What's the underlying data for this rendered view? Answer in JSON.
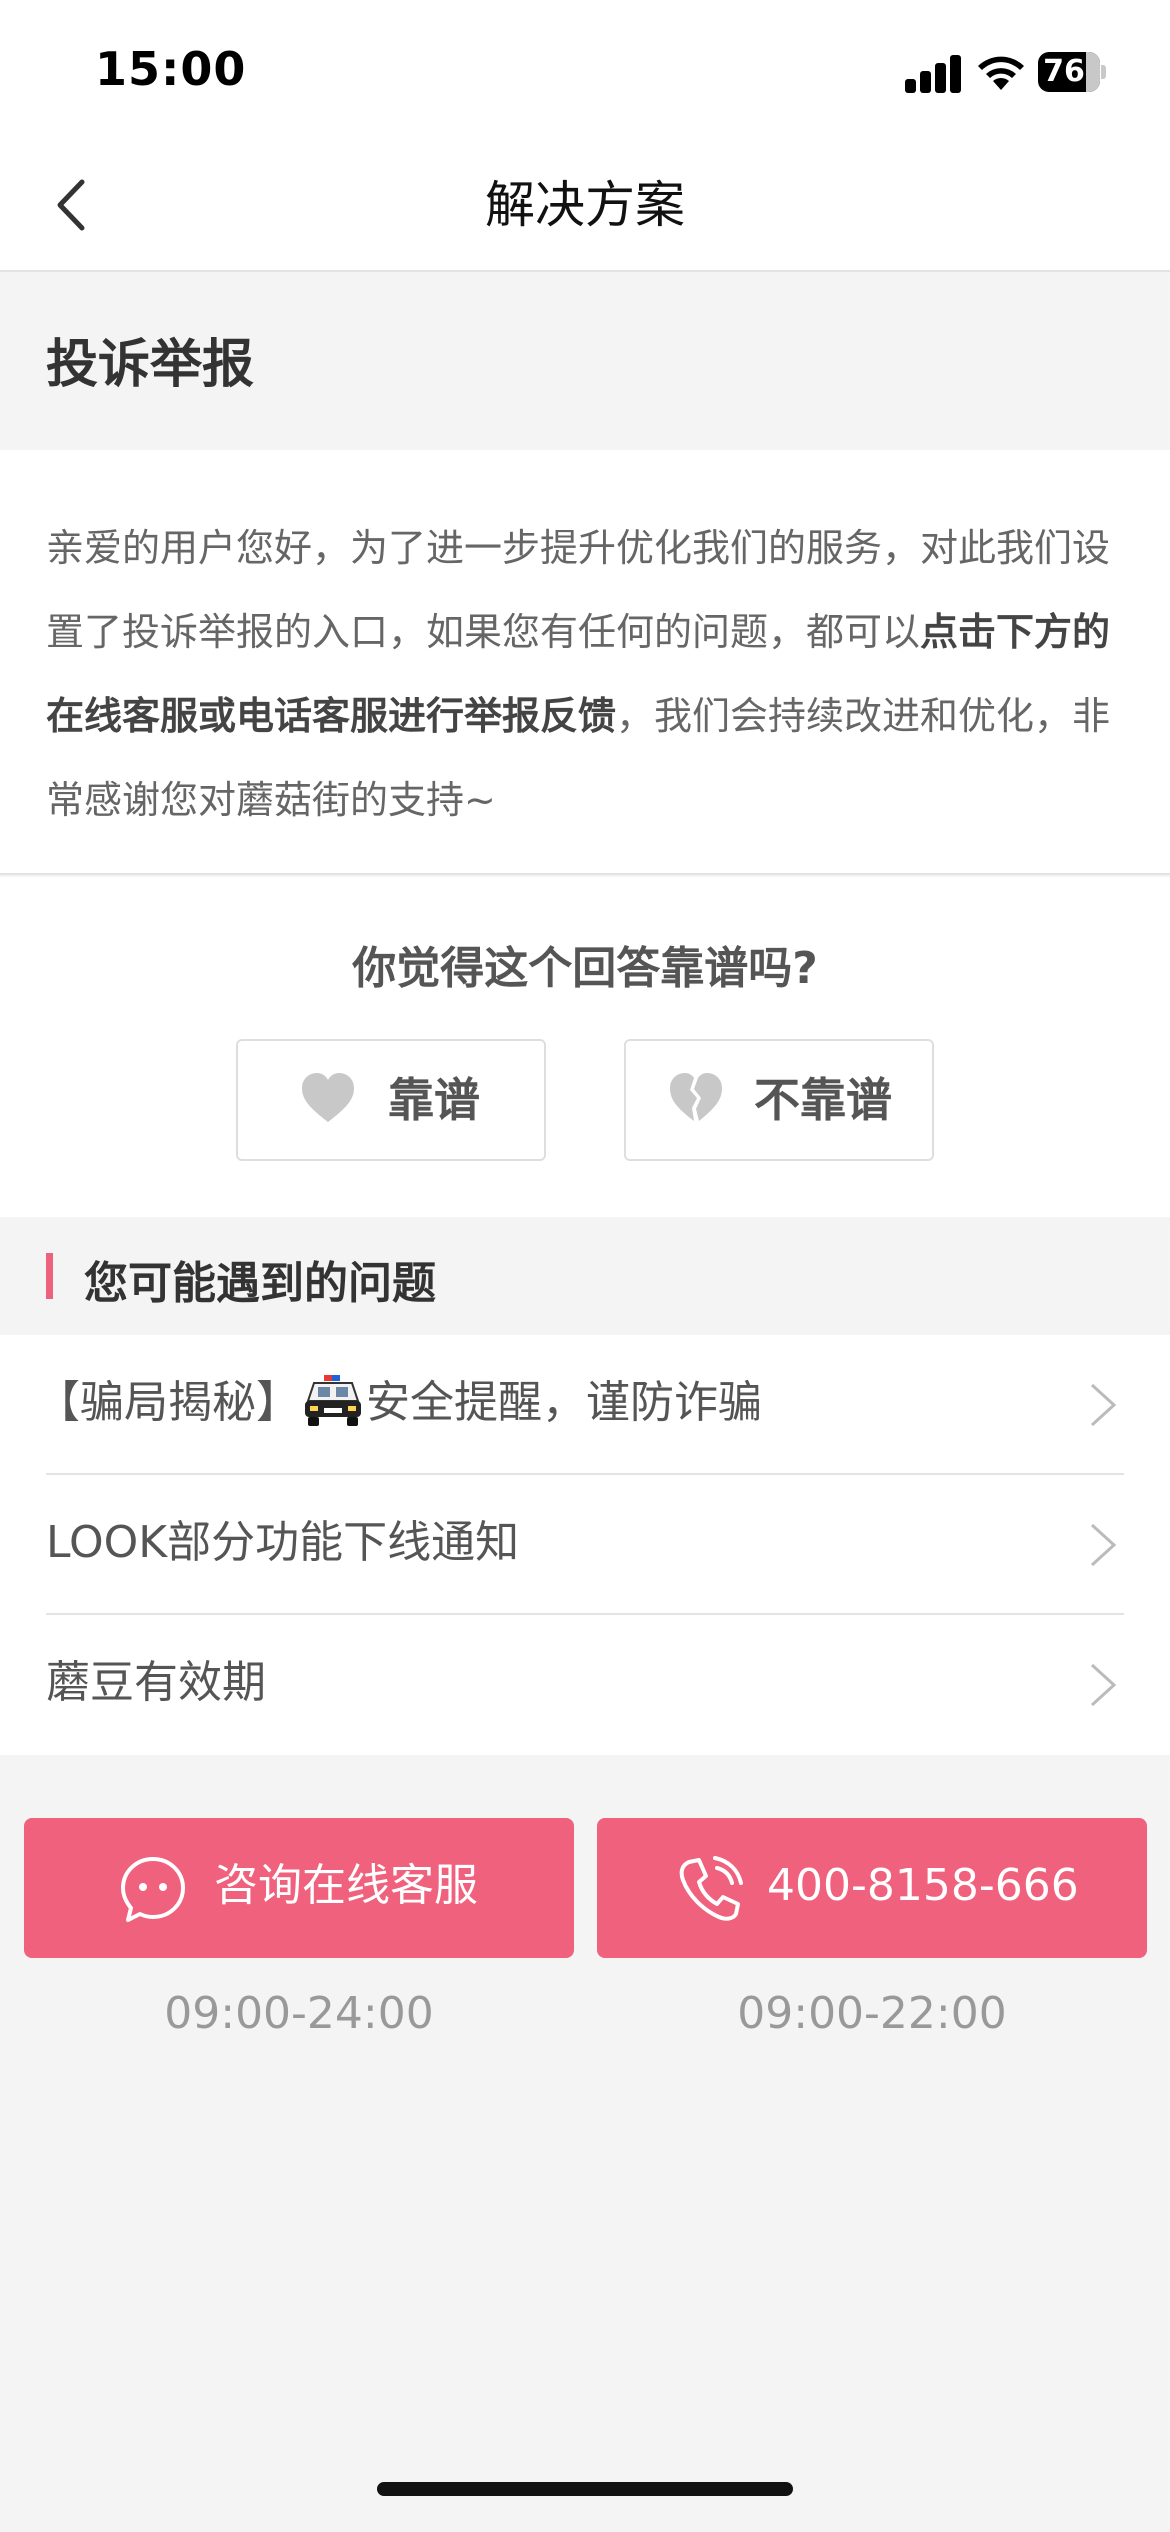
{
  "status_bar": {
    "time": "15:00",
    "battery": "76"
  },
  "nav": {
    "title": "解决方案",
    "back_icon": "chevron-left-icon"
  },
  "section": {
    "title": "投诉举报"
  },
  "answer": {
    "text_before": "亲爱的用户您好，为了进一步提升优化我们的服务，对此我们设置了投诉举报的入口，如果您有任何的问题，都可以",
    "text_bold": "点击下方的在线客服或电话客服进行举报反馈",
    "text_after": "，我们会持续改进和优化，非常感谢您对蘑菇街的支持~"
  },
  "feedback": {
    "question": "你觉得这个回答靠谱吗?",
    "good_label": "靠谱",
    "bad_label": "不靠谱",
    "good_icon": "heart-icon",
    "bad_icon": "broken-heart-icon"
  },
  "issues": {
    "title": "您可能遇到的问题",
    "accent_color": "#ee617c",
    "items": [
      {
        "prefix": "【骗局揭秘】",
        "icon": "police-car-icon",
        "suffix": "安全提醒，谨防诈骗"
      },
      {
        "prefix": "LOOK部分功能下线通知",
        "icon": "",
        "suffix": ""
      },
      {
        "prefix": "蘑豆有效期",
        "icon": "",
        "suffix": ""
      }
    ]
  },
  "contact": {
    "button_color": "#ef617c",
    "online": {
      "label": "咨询在线客服",
      "hours": "09:00-24:00",
      "icon": "chat-bubble-icon"
    },
    "phone": {
      "label": "400-8158-666",
      "hours": "09:00-22:00",
      "icon": "phone-icon"
    }
  }
}
